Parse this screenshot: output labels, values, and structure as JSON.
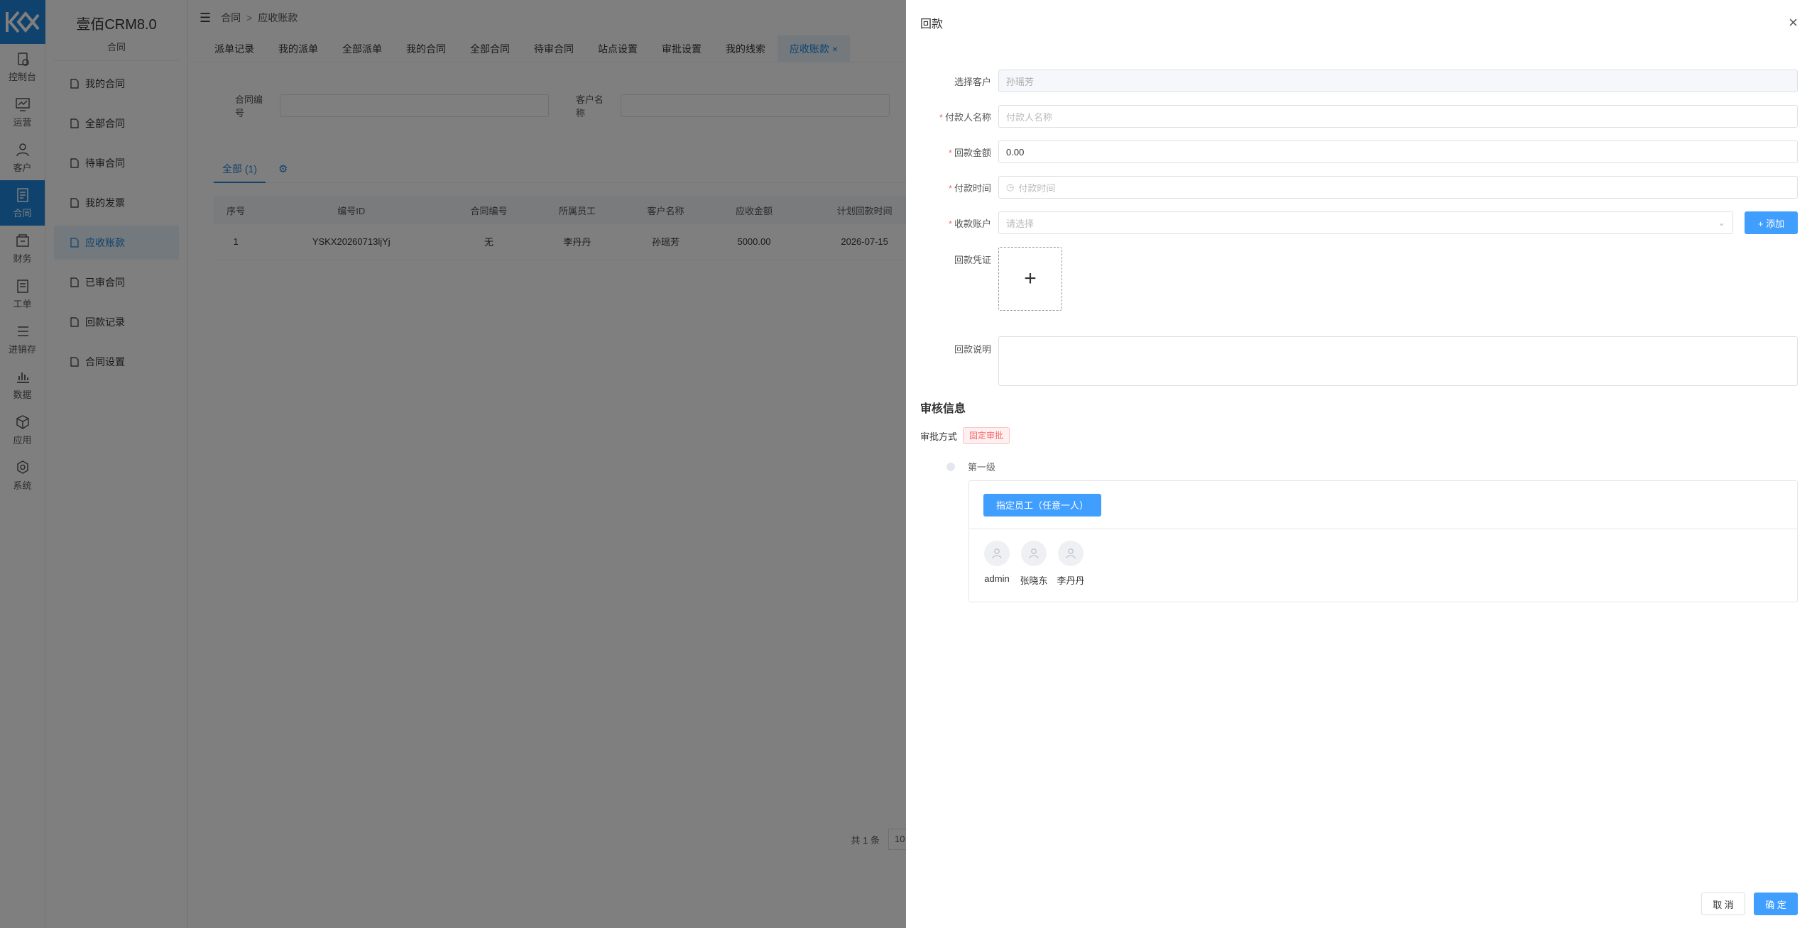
{
  "app": {
    "title": "壹佰CRM8.0",
    "group": "合同"
  },
  "leftnav": [
    {
      "label": "控制台",
      "icon": "dashboard-icon"
    },
    {
      "label": "运营",
      "icon": "chart-icon"
    },
    {
      "label": "客户",
      "icon": "user-icon"
    },
    {
      "label": "合同",
      "icon": "contract-icon",
      "active": true
    },
    {
      "label": "财务",
      "icon": "finance-icon"
    },
    {
      "label": "工单",
      "icon": "ticket-icon"
    },
    {
      "label": "进销存",
      "icon": "list-icon"
    },
    {
      "label": "数据",
      "icon": "bar-chart-icon"
    },
    {
      "label": "应用",
      "icon": "cube-icon"
    },
    {
      "label": "系统",
      "icon": "settings-icon"
    }
  ],
  "subnav": [
    "我的合同",
    "全部合同",
    "待审合同",
    "我的发票",
    "应收账款",
    "已审合同",
    "回款记录",
    "合同设置"
  ],
  "breadcrumb": {
    "a": "合同",
    "sep": ">",
    "b": "应收账款"
  },
  "tabs": [
    "派单记录",
    "我的派单",
    "全部派单",
    "我的合同",
    "全部合同",
    "待审合同",
    "站点设置",
    "审批设置",
    "我的线索",
    "应收账款 ×"
  ],
  "filters": {
    "contract_no": "合同编号",
    "customer_name": "客户名称"
  },
  "table_tab": "全部 (1)",
  "table": {
    "headers": [
      "序号",
      "编号ID",
      "合同编号",
      "所属员工",
      "客户名称",
      "应收金额",
      "计划回款时间"
    ],
    "rows": [
      [
        "1",
        "YSKX20260713ljYj",
        "无",
        "李丹丹",
        "孙瑶芳",
        "5000.00",
        "2026-07-15"
      ]
    ]
  },
  "pager": {
    "total": "共 1 条",
    "size": "10"
  },
  "drawer": {
    "title": "回款",
    "close": "×",
    "customer_label": "选择客户",
    "customer_value": "孙瑶芳",
    "payer_label": "付款人名称",
    "payer_placeholder": "付款人名称",
    "amount_label": "回款金额",
    "amount_value": "0.00",
    "time_label": "付款时间",
    "time_placeholder": "付款时间",
    "account_label": "收款账户",
    "account_placeholder": "请选择",
    "add_label": "+ 添加",
    "voucher_label": "回款凭证",
    "note_label": "回款说明",
    "section_title": "审核信息",
    "approve_label": "审批方式",
    "approve_tag": "固定审批",
    "level": "第一级",
    "assign_btn": "指定员工（任意一人）",
    "users": [
      "admin",
      "张晓东",
      "李丹丹"
    ],
    "cancel": "取 消",
    "ok": "确 定"
  }
}
